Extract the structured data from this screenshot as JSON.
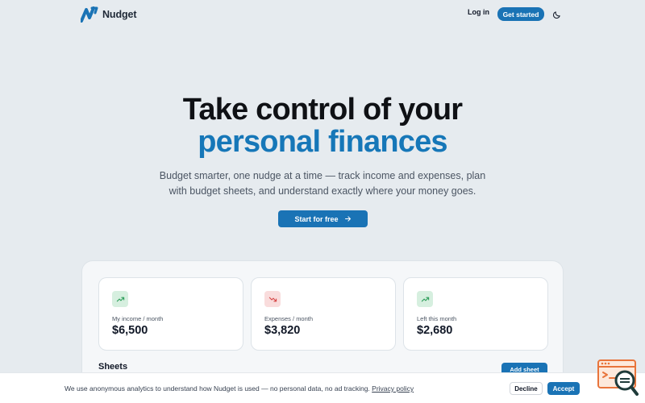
{
  "header": {
    "brand": "Nudget",
    "login_label": "Log in",
    "cta_label": "Get started",
    "theme_icon": "moon-icon"
  },
  "hero": {
    "title_line1": "Take control of your",
    "title_line2": "personal finances",
    "subtitle": "Budget smarter, one nudge at a time — track income and expenses, plan with budget sheets, and understand exactly where your money goes.",
    "cta_label": "Start for free",
    "cta_icon": "arrow-right-icon"
  },
  "preview": {
    "cards": [
      {
        "label": "My income / month",
        "value": "$6,500",
        "icon": "trending-up-icon"
      },
      {
        "label": "Expenses / month",
        "value": "$3,820",
        "icon": "trending-down-icon"
      },
      {
        "label": "Left this month",
        "value": "$2,680",
        "icon": "trending-up-icon"
      }
    ],
    "sheets_title": "Sheets",
    "add_sheet_label": "Add sheet"
  },
  "cookie": {
    "text": "We use anonymous analytics to understand how Nudget is used — no personal data, no ad tracking.",
    "link_label": "Privacy policy",
    "decline_label": "Decline",
    "accept_label": "Accept"
  },
  "widget": {
    "icon": "feedback-search-icon"
  },
  "colors": {
    "accent": "#1a73b5",
    "heading_accent": "#1677b8",
    "background": "#e6ebef",
    "positive_bg": "#d6efdf",
    "positive": "#2f9e5b",
    "negative_bg": "#f9dcdc",
    "negative": "#d64545"
  }
}
